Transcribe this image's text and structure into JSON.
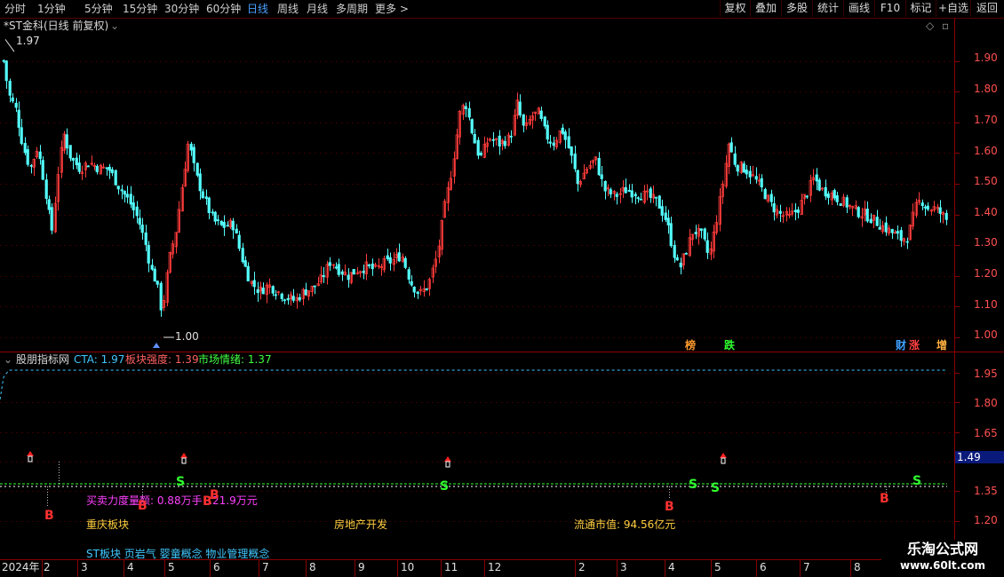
{
  "toolbar": {
    "periods": [
      "分时",
      "1分钟",
      "5分钟",
      "15分钟",
      "30分钟",
      "60分钟",
      "日线",
      "周线",
      "月线",
      "多周期",
      "更多 >"
    ],
    "active_period": "日线",
    "right_buttons": [
      "复权",
      "叠加",
      "多股",
      "统计",
      "画线",
      "F10",
      "标记",
      "+自选",
      "返回"
    ]
  },
  "main_chart": {
    "title": "*ST金科(日线 前复权)",
    "price_labels": [
      "1.90",
      "1.80",
      "1.70",
      "1.60",
      "1.50",
      "1.40",
      "1.30",
      "1.20",
      "1.10",
      "1.00"
    ],
    "high_marker": "1.97",
    "low_marker": "1.00",
    "event_tags": [
      {
        "label": "榜",
        "color": "#ff9a2e"
      },
      {
        "label": "跌",
        "color": "#30ff30"
      },
      {
        "label": "财",
        "color": "#40a0ff"
      },
      {
        "label": "涨",
        "color": "#ff4040"
      },
      {
        "label": "增",
        "color": "#ffb040"
      }
    ]
  },
  "indicator": {
    "name": "股朋指标网",
    "cta_label": "CTA: 1.97",
    "bk_label": "板块强度: 1.39",
    "sc_label": "市场情绪: 1.37",
    "axis_labels": [
      "1.95",
      "1.80",
      "1.65",
      "1.35",
      "1.20"
    ],
    "current_value": "1.49",
    "flow_text": "买卖力度量额: 0.88万手  121.9万元",
    "sector_text": "重庆板块",
    "industry_text": "房地产开发",
    "market_cap_text": "流通市值: 94.56亿元",
    "concepts_text": "ST板块 页岩气 婴童概念 物业管理概念",
    "b_signal": "B",
    "s_signal": "S"
  },
  "chart_data": {
    "type": "candlestick",
    "ylim": [
      0.97,
      1.97
    ],
    "x": [
      "2024年",
      "2",
      "3",
      "4",
      "5",
      "6",
      "7",
      "8",
      "9",
      "10",
      "11",
      "12",
      "2",
      "3",
      "4",
      "5",
      "6",
      "7",
      "8"
    ],
    "y_ticks": [
      1.9,
      1.8,
      1.7,
      1.6,
      1.5,
      1.4,
      1.3,
      1.2,
      1.1,
      1.0
    ],
    "high": 1.97,
    "low": 1.0,
    "indicator_ylim": [
      1.15,
      2.0
    ],
    "indicator_current": 1.49
  },
  "timeline": {
    "labels": [
      "2024年",
      "2",
      "3",
      "4",
      "5",
      "6",
      "7",
      "8",
      "9",
      "10",
      "11",
      "12",
      "2",
      "3",
      "4",
      "5",
      "6",
      "7",
      "8"
    ]
  },
  "watermark": {
    "line1": "乐淘公式网",
    "line2": "www.60lt.com"
  }
}
